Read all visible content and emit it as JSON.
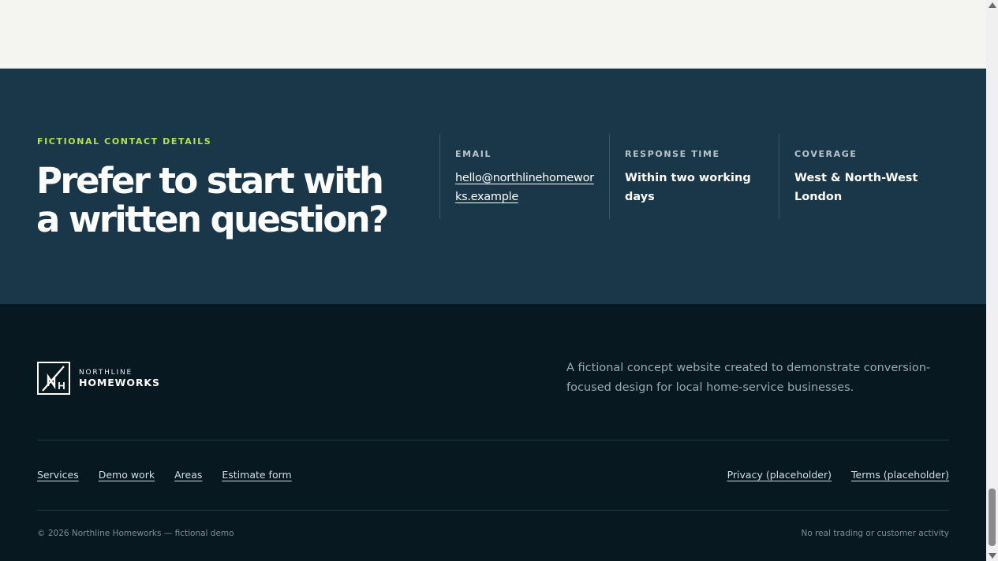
{
  "contact": {
    "eyebrow": "FICTIONAL CONTACT DETAILS",
    "headline": "Prefer to start with a written question?",
    "details": [
      {
        "label": "EMAIL",
        "value": "hello@northlinehomeworks.example"
      },
      {
        "label": "RESPONSE TIME",
        "value": "Within two working days"
      },
      {
        "label": "COVERAGE",
        "value": "West & North-West London"
      }
    ]
  },
  "footer": {
    "logo": {
      "top": "NORTHLINE",
      "bottom": "HOMEWORKS",
      "mark_letters": "NH"
    },
    "tagline": "A fictional concept website created to demonstrate conversion-focused design for local home-service businesses.",
    "nav_left": [
      "Services",
      "Demo work",
      "Areas",
      "Estimate form"
    ],
    "nav_right": [
      "Privacy (placeholder)",
      "Terms (placeholder)"
    ],
    "copyright": "© 2026 Northline Homeworks — fictional demo",
    "disclaimer": "No real trading or customer activity"
  },
  "colors": {
    "accent": "#b7e34a",
    "contact_bg": "#193748",
    "footer_bg": "#071820",
    "page_bg": "#f4f5f1"
  }
}
